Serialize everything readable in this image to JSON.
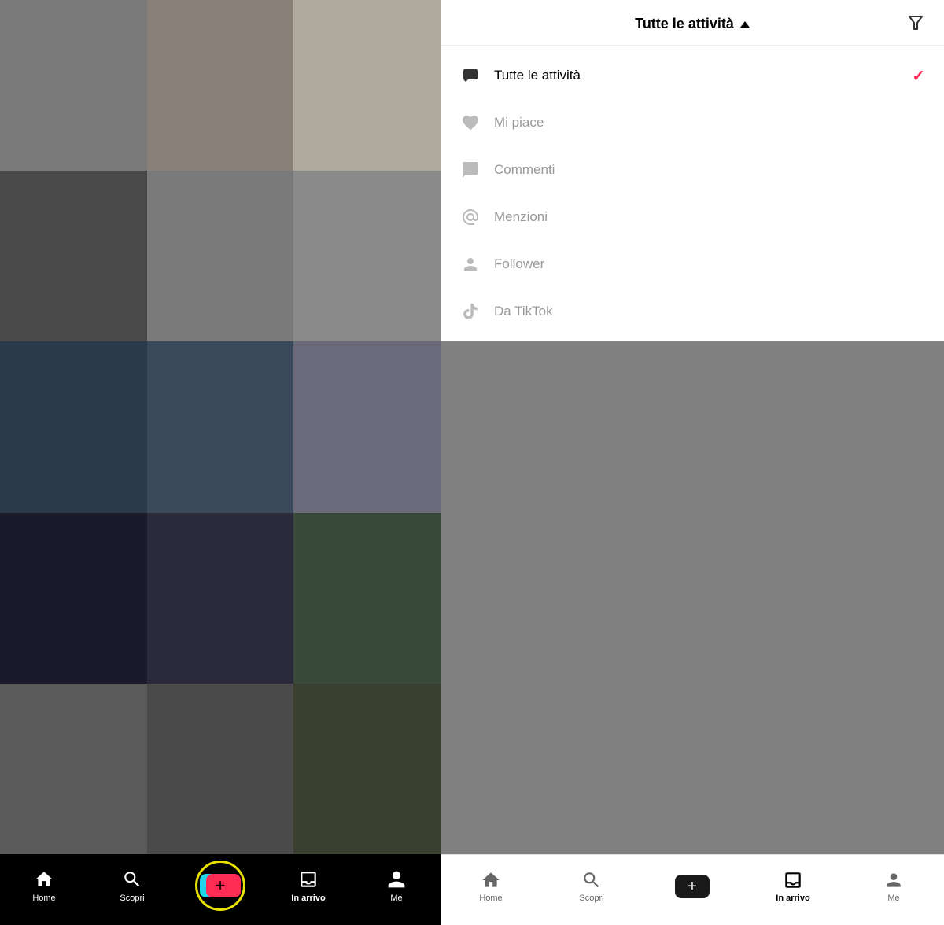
{
  "left": {
    "mosaic_colors": [
      "#7a7a7a",
      "#8a8078",
      "#b0a99e",
      "#4a4a4a",
      "#7a7a7a",
      "#8a8a8a",
      "#2a3a4a",
      "#3a4a5a",
      "#6a6a7a",
      "#1a1a2a",
      "#2a2a3a",
      "#3a4a3a",
      "#5a5a5a",
      "#4a4a4a",
      "#3a4030"
    ],
    "nav": {
      "home_label": "Home",
      "scopri_label": "Scopri",
      "in_arrivo_label": "In arrivo",
      "me_label": "Me"
    }
  },
  "right": {
    "header": {
      "title": "Tutte le attività",
      "chevron": "▲"
    },
    "menu_items": [
      {
        "id": "tutte",
        "label": "Tutte le attività",
        "active": true,
        "icon": "chat-icon"
      },
      {
        "id": "mipiace",
        "label": "Mi piace",
        "active": false,
        "icon": "heart-icon"
      },
      {
        "id": "commenti",
        "label": "Commenti",
        "active": false,
        "icon": "comment-icon"
      },
      {
        "id": "menzioni",
        "label": "Menzioni",
        "active": false,
        "icon": "mention-icon"
      },
      {
        "id": "follower",
        "label": "Follower",
        "active": false,
        "icon": "person-icon"
      },
      {
        "id": "datiktok",
        "label": "Da TikTok",
        "active": false,
        "icon": "tiktok-icon"
      }
    ],
    "nav": {
      "home_label": "Home",
      "scopri_label": "Scopri",
      "in_arrivo_label": "In arrivo",
      "me_label": "Me"
    }
  }
}
